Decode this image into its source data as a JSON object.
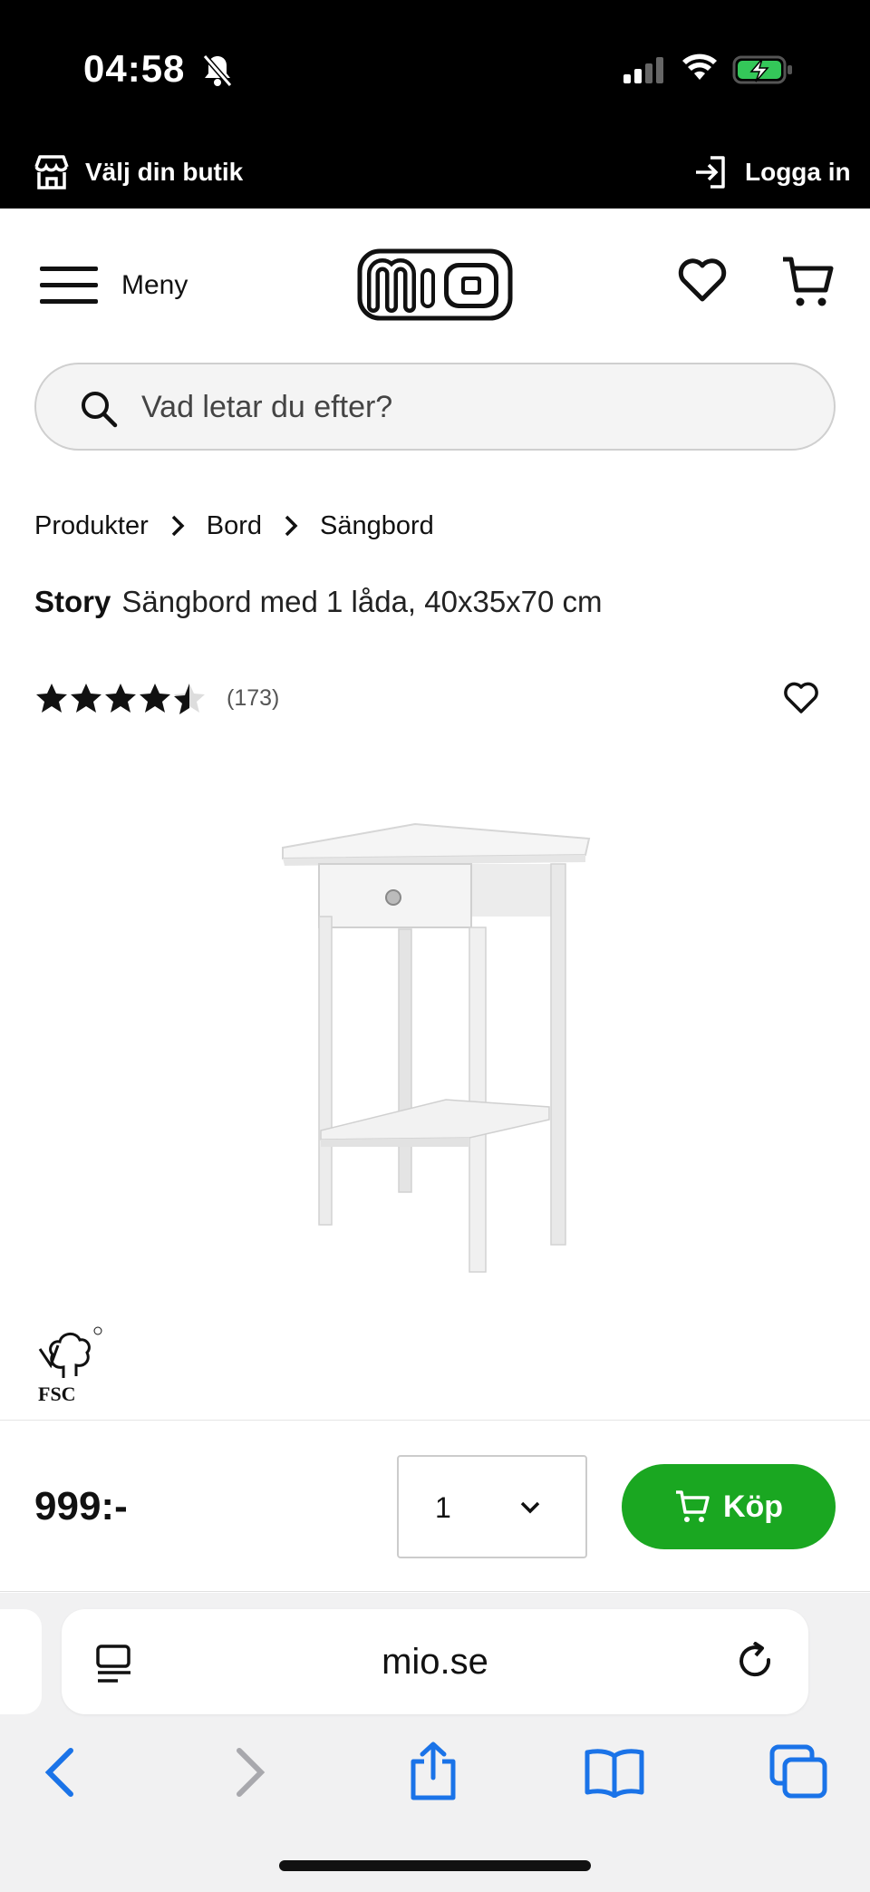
{
  "status_bar": {
    "time": "04:58",
    "icons": [
      "bell-slash-icon",
      "cellular-signal-icon",
      "wifi-icon",
      "battery-charging-icon"
    ],
    "battery_color": "#34c759"
  },
  "store_bar": {
    "store_label": "Välj din butik",
    "login_label": "Logga in"
  },
  "header": {
    "menu_label": "Meny",
    "logo_text": "mio"
  },
  "search": {
    "placeholder": "Vad letar du efter?"
  },
  "breadcrumb": {
    "items": [
      "Produkter",
      "Bord",
      "Sängbord"
    ]
  },
  "product": {
    "brand": "Story",
    "description": "Sängbord med 1 låda, 40x35x70 cm",
    "rating": 4.5,
    "review_count": "(173)",
    "certification": "FSC"
  },
  "purchase": {
    "price": "999:-",
    "quantity": "1",
    "buy_label": "Köp",
    "buy_color": "#1aa721"
  },
  "browser": {
    "url": "mio.se"
  }
}
